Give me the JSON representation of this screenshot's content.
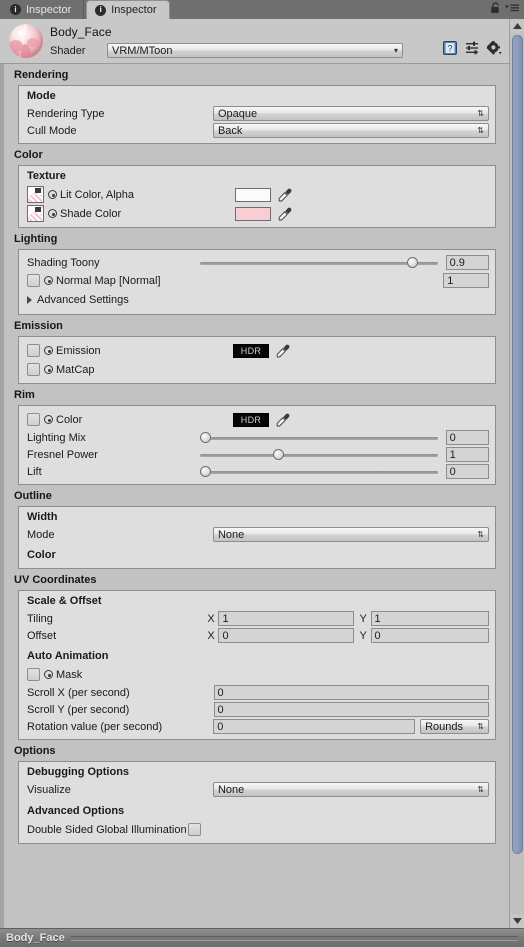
{
  "window": {
    "tabs": [
      {
        "label": "Inspector",
        "icon": "info-icon",
        "active": false
      },
      {
        "label": "Inspector",
        "icon": "info-icon",
        "active": true
      }
    ],
    "lock_icon": "lock-icon",
    "menu_icon": "hamburger-menu-icon"
  },
  "header": {
    "material_name": "Body_Face",
    "shader_label": "Shader",
    "shader_value": "VRM/MToon",
    "icons": [
      "help-book-icon",
      "preset-icon",
      "gear-icon"
    ]
  },
  "sections": {
    "rendering": {
      "title": "Rendering",
      "mode_title": "Mode",
      "rendering_type_label": "Rendering Type",
      "rendering_type_value": "Opaque",
      "cull_mode_label": "Cull Mode",
      "cull_mode_value": "Back"
    },
    "color": {
      "title": "Color",
      "texture_title": "Texture",
      "lit_color_label": "Lit Color, Alpha",
      "lit_color_swatch": "#fbfbfb",
      "shade_color_label": "Shade Color",
      "shade_color_swatch": "#f7ced4"
    },
    "lighting": {
      "title": "Lighting",
      "shading_toony_label": "Shading Toony",
      "shading_toony_value": "0.9",
      "shading_toony_pct": 87,
      "normal_map_label": "Normal Map [Normal]",
      "normal_map_value": "1",
      "advanced_settings_label": "Advanced Settings"
    },
    "emission": {
      "title": "Emission",
      "emission_label": "Emission",
      "emission_hdr": "HDR",
      "matcap_label": "MatCap"
    },
    "rim": {
      "title": "Rim",
      "color_label": "Color",
      "color_hdr": "HDR",
      "lighting_mix_label": "Lighting Mix",
      "lighting_mix_value": "0",
      "lighting_mix_pct": 1,
      "fresnel_power_label": "Fresnel Power",
      "fresnel_power_value": "1",
      "fresnel_power_pct": 31,
      "lift_label": "Lift",
      "lift_value": "0",
      "lift_pct": 1
    },
    "outline": {
      "title": "Outline",
      "width_title": "Width",
      "mode_label": "Mode",
      "mode_value": "None",
      "color_title": "Color"
    },
    "uv": {
      "title": "UV Coordinates",
      "scale_offset_title": "Scale & Offset",
      "tiling_label": "Tiling",
      "tiling_x_label": "X",
      "tiling_x_value": "1",
      "tiling_y_label": "Y",
      "tiling_y_value": "1",
      "offset_label": "Offset",
      "offset_x_label": "X",
      "offset_x_value": "0",
      "offset_y_label": "Y",
      "offset_y_value": "0",
      "auto_animation_title": "Auto Animation",
      "mask_label": "Mask",
      "scroll_x_label": "Scroll X (per second)",
      "scroll_x_value": "0",
      "scroll_y_label": "Scroll Y (per second)",
      "scroll_y_value": "0",
      "rotation_label": "Rotation value (per second)",
      "rotation_value": "0",
      "rotation_unit": "Rounds"
    },
    "options": {
      "title": "Options",
      "debugging_title": "Debugging Options",
      "visualize_label": "Visualize",
      "visualize_value": "None",
      "advanced_title": "Advanced Options",
      "double_sided_gi_label": "Double Sided Global Illumination"
    }
  },
  "statusbar": {
    "text": "Body_Face"
  }
}
